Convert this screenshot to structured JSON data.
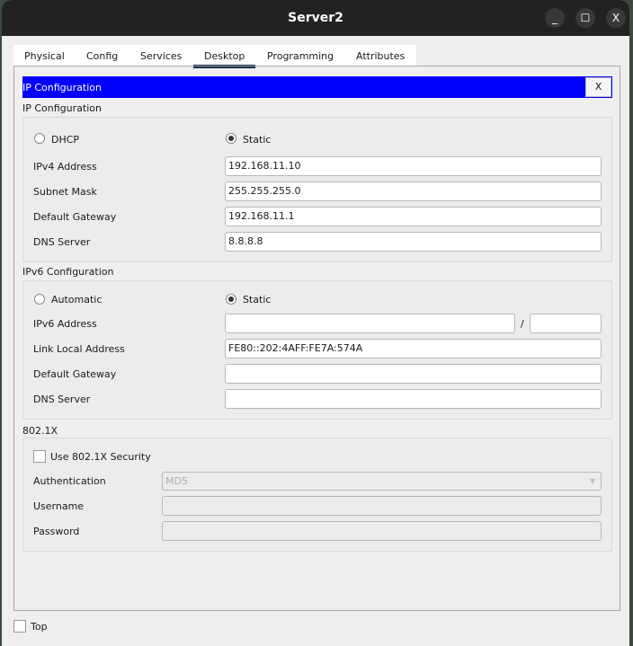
{
  "window": {
    "title": "Server2",
    "minimize": "_",
    "maximize": "☐",
    "close": "X"
  },
  "tabs": [
    "Physical",
    "Config",
    "Services",
    "Desktop",
    "Programming",
    "Attributes"
  ],
  "app": {
    "title": "IP Configuration",
    "close": "X"
  },
  "ip": {
    "heading": "IP Configuration",
    "dhcp": "DHCP",
    "static": "Static",
    "mode": "Static",
    "ipv4_label": "IPv4 Address",
    "ipv4": "192.168.11.10",
    "mask_label": "Subnet Mask",
    "mask": "255.255.255.0",
    "gw_label": "Default Gateway",
    "gw": "192.168.11.1",
    "dns_label": "DNS Server",
    "dns": "8.8.8.8"
  },
  "ipv6": {
    "heading": "IPv6 Configuration",
    "automatic": "Automatic",
    "static": "Static",
    "mode": "Static",
    "addr_label": "IPv6 Address",
    "addr": "",
    "slash": "/",
    "prefix": "",
    "ll_label": "Link Local Address",
    "ll": "FE80::202:4AFF:FE7A:574A",
    "gw_label": "Default Gateway",
    "gw": "",
    "dns_label": "DNS Server",
    "dns": ""
  },
  "dot1x": {
    "heading": "802.1X",
    "use_label": "Use 802.1X Security",
    "use": false,
    "auth_label": "Authentication",
    "auth": "MD5",
    "user_label": "Username",
    "user": "",
    "pass_label": "Password",
    "pass": ""
  },
  "footer": {
    "top_label": "Top",
    "top": false
  }
}
